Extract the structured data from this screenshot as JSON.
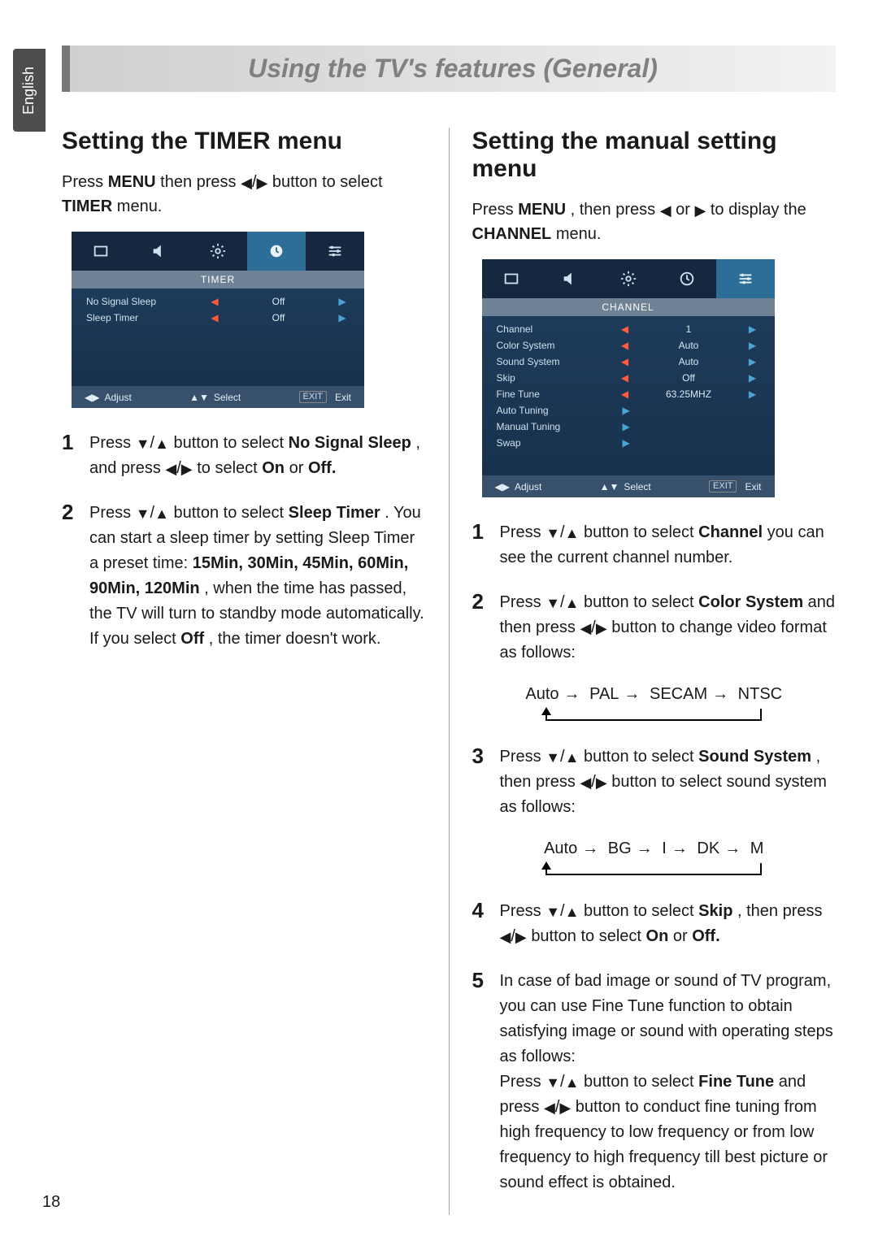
{
  "language_tab": "English",
  "page_title": "Using the TV's features (General)",
  "page_number": "18",
  "left": {
    "heading": "Setting the TIMER menu",
    "intro_pre": "Press ",
    "intro_menu": "MENU",
    "intro_mid": " then press ",
    "intro_post": " button to select ",
    "intro_timer": "TIMER",
    "intro_end": " menu.",
    "osd": {
      "menu_title": "TIMER",
      "rows": [
        {
          "label": "No Signal Sleep",
          "value": "Off",
          "left_arrow": true,
          "right_arrow": true
        },
        {
          "label": "Sleep Timer",
          "value": "Off",
          "left_arrow": true,
          "right_arrow": true
        }
      ],
      "footer": {
        "adjust": "Adjust",
        "select": "Select",
        "exit_btn": "EXIT",
        "exit": "Exit"
      },
      "active_tab_index": 3
    },
    "step1_a": "Press ",
    "step1_b": " button to select ",
    "step1_item": "No Signal Sleep",
    "step1_c": ", and press ",
    "step1_d": " to select ",
    "step1_on": "On",
    "step1_or": " or ",
    "step1_off": "Off.",
    "step2_a": "Press ",
    "step2_b": " button to select ",
    "step2_item": "Sleep Timer",
    "step2_c": ". You can start a sleep timer by setting Sleep Timer a preset time: ",
    "step2_times": "15Min, 30Min, 45Min, 60Min, 90Min, 120Min",
    "step2_d": ", when the time has passed, the TV will turn to standby mode automatically.",
    "step2_e_pre": "If you select ",
    "step2_e_off": "Off",
    "step2_e_post": ", the timer doesn't work."
  },
  "right": {
    "heading": "Setting the manual setting menu",
    "intro_pre": "Press ",
    "intro_menu": "MENU",
    "intro_mid": ", then press ",
    "intro_or": " or ",
    "intro_post": " to display the ",
    "intro_channel": "CHANNEL",
    "intro_end": " menu.",
    "osd": {
      "menu_title": "CHANNEL",
      "rows": [
        {
          "label": "Channel",
          "value": "1",
          "left_arrow": true,
          "right_arrow": true
        },
        {
          "label": "Color System",
          "value": "Auto",
          "left_arrow": true,
          "right_arrow": true
        },
        {
          "label": "Sound System",
          "value": "Auto",
          "left_arrow": true,
          "right_arrow": true
        },
        {
          "label": "Skip",
          "value": "Off",
          "left_arrow": true,
          "right_arrow": true
        },
        {
          "label": "Fine Tune",
          "value": "63.25MHZ",
          "left_arrow": true,
          "right_arrow": true
        },
        {
          "label": "Auto Tuning",
          "submenu": true
        },
        {
          "label": "Manual Tuning",
          "submenu": true
        },
        {
          "label": "Swap",
          "submenu": true
        }
      ],
      "footer": {
        "adjust": "Adjust",
        "select": "Select",
        "exit_btn": "EXIT",
        "exit": "Exit"
      },
      "active_tab_index": 4
    },
    "step1_a": "Press ",
    "step1_b": " button to select ",
    "step1_item": "Channel",
    "step1_c": " you can see the current channel number.",
    "step2_a": "Press ",
    "step2_b": " button to select ",
    "step2_item": "Color System",
    "step2_c": " and then press ",
    "step2_d": " button to change video format as follows:",
    "cycle_color": [
      "Auto",
      "PAL",
      "SECAM",
      "NTSC"
    ],
    "step3_a": "Press ",
    "step3_b": " button to select ",
    "step3_item": "Sound System",
    "step3_c": ", then press ",
    "step3_d": " button to select sound system as follows:",
    "cycle_sound": [
      "Auto",
      "BG",
      "I",
      "DK",
      "M"
    ],
    "step4_a": "Press ",
    "step4_b": " button to select ",
    "step4_item": "Skip",
    "step4_c": ", then press ",
    "step4_d": " button to select ",
    "step4_on": "On",
    "step4_or": " or ",
    "step4_off": "Off.",
    "step5_a": "In case of bad image or sound of TV program, you can use Fine Tune function to obtain satisfying image or sound with operating steps as follows:",
    "step5_b": "Press ",
    "step5_c": " button to select ",
    "step5_item": "Fine Tune",
    "step5_d": " and press ",
    "step5_e": " button to conduct fine tuning from high frequency to low frequency or from low frequency to high frequency till best picture or sound effect is obtained."
  }
}
